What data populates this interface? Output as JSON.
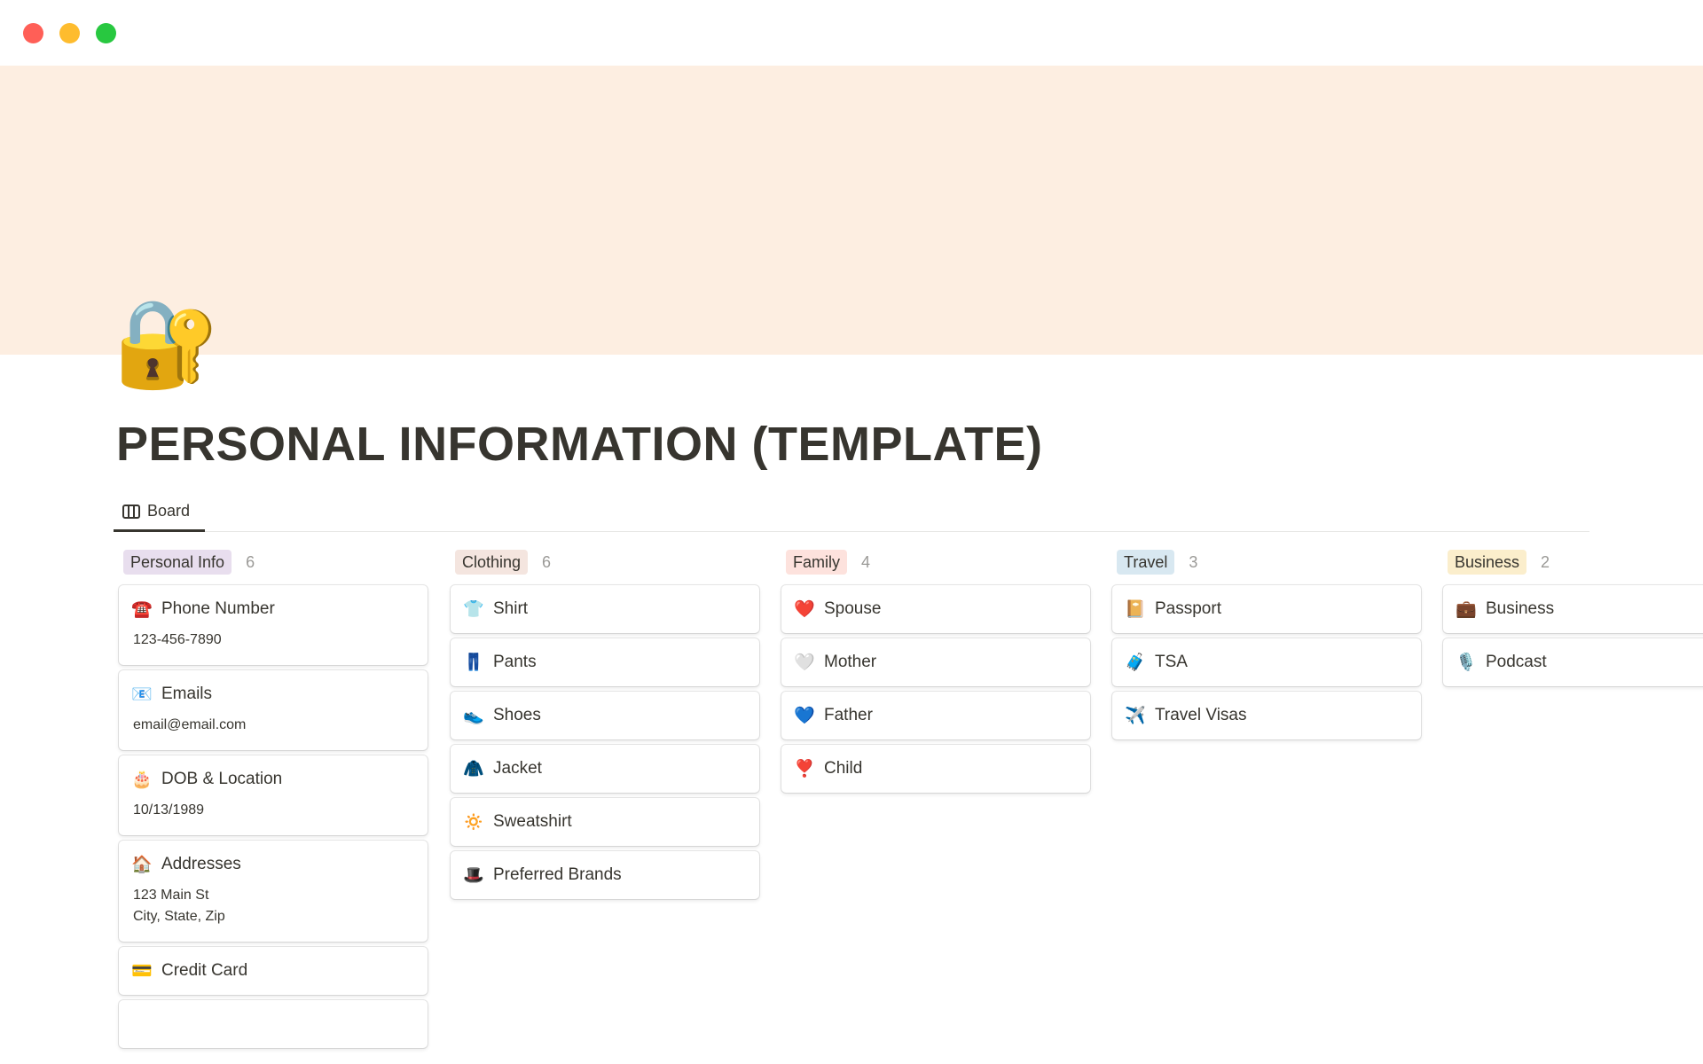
{
  "window": {
    "controls": [
      {
        "name": "close",
        "color": "#ff5f57"
      },
      {
        "name": "minimize",
        "color": "#febc2e"
      },
      {
        "name": "maximize",
        "color": "#28c840"
      }
    ]
  },
  "cover": {
    "color": "#fdeee1"
  },
  "page": {
    "icon": "🔐",
    "title": "PERSONAL INFORMATION (TEMPLATE)"
  },
  "view": {
    "tab_label": "Board"
  },
  "columns": [
    {
      "label": "Personal Info",
      "count": "6",
      "color": "#e8deee",
      "cards": [
        {
          "icon": "☎️",
          "title": "Phone Number",
          "property": "123-456-7890"
        },
        {
          "icon": "📧",
          "title": "Emails",
          "property": "email@email.com"
        },
        {
          "icon": "🎂",
          "title": "DOB & Location",
          "property": "10/13/1989"
        },
        {
          "icon": "🏠",
          "title": "Addresses",
          "property": "123 Main St\nCity, State, Zip"
        },
        {
          "icon": "💳",
          "title": "Credit Card"
        },
        {
          "icon": "",
          "title": ""
        }
      ]
    },
    {
      "label": "Clothing",
      "count": "6",
      "color": "#f4e5df",
      "cards": [
        {
          "icon": "👕",
          "title": "Shirt"
        },
        {
          "icon": "👖",
          "title": "Pants"
        },
        {
          "icon": "👟",
          "title": "Shoes"
        },
        {
          "icon": "🧥",
          "title": "Jacket"
        },
        {
          "icon": "🔅",
          "title": "Sweatshirt"
        },
        {
          "icon": "🎩",
          "title": "Preferred Brands"
        }
      ]
    },
    {
      "label": "Family",
      "count": "4",
      "color": "#fde2dd",
      "cards": [
        {
          "icon": "❤️",
          "title": "Spouse"
        },
        {
          "icon": "🤍",
          "title": "Mother"
        },
        {
          "icon": "💙",
          "title": "Father"
        },
        {
          "icon": "❣️",
          "title": "Child"
        }
      ]
    },
    {
      "label": "Travel",
      "count": "3",
      "color": "#d8e8f1",
      "cards": [
        {
          "icon": "📔",
          "title": "Passport"
        },
        {
          "icon": "🧳",
          "title": "TSA"
        },
        {
          "icon": "✈️",
          "title": "Travel Visas"
        }
      ]
    },
    {
      "label": "Business",
      "count": "2",
      "color": "#fbeecc",
      "cards": [
        {
          "icon": "💼",
          "title": "Business"
        },
        {
          "icon": "🎙️",
          "title": "Podcast"
        }
      ]
    }
  ]
}
